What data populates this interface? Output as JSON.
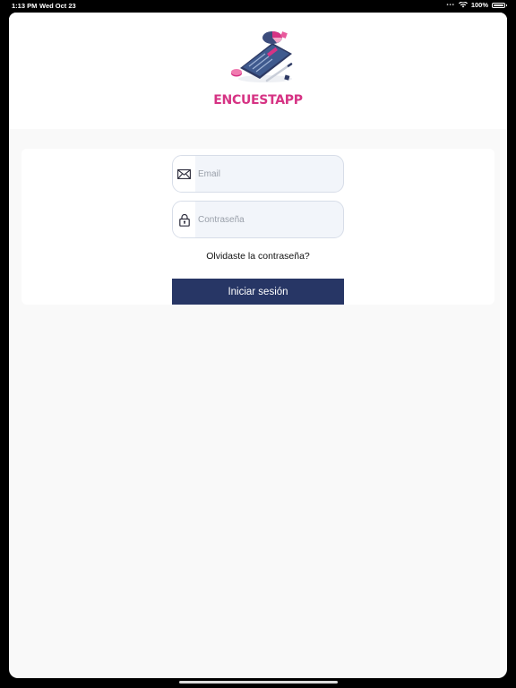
{
  "status_bar": {
    "time": "1:13 PM",
    "date": "Wed Oct 23",
    "battery": "100%"
  },
  "app": {
    "brand_name": "ENCUESTAPP",
    "brand_color": "#d63384"
  },
  "login": {
    "email_placeholder": "Email",
    "password_placeholder": "Contraseña",
    "forgot_label": "Olvidaste la contraseña?",
    "submit_label": "Iniciar sesión",
    "submit_color": "#273665"
  },
  "icons": {
    "email": "envelope-icon",
    "password": "lock-icon"
  }
}
